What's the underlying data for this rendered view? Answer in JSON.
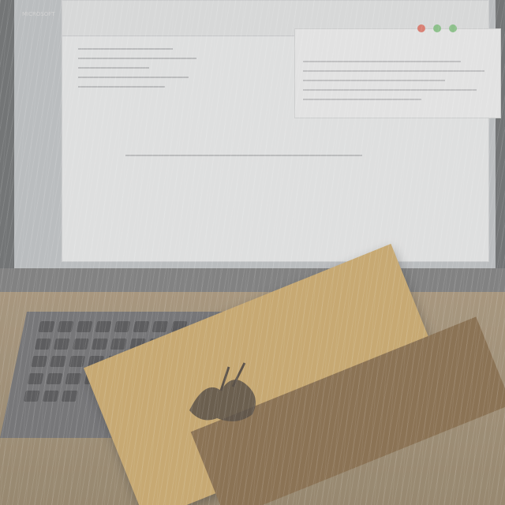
{
  "photo": {
    "subject": "",
    "desktop_label": "MICROSOFT",
    "book_title": "",
    "colors": {
      "bezel": "#5a5c5e",
      "desktop": "#b9bcbf",
      "document": "#e9eaea",
      "desk": "#8a7656",
      "book": "#caa25a",
      "rain_overlay": "#bebebe"
    },
    "window_buttons": [
      "red",
      "green",
      "green"
    ]
  }
}
